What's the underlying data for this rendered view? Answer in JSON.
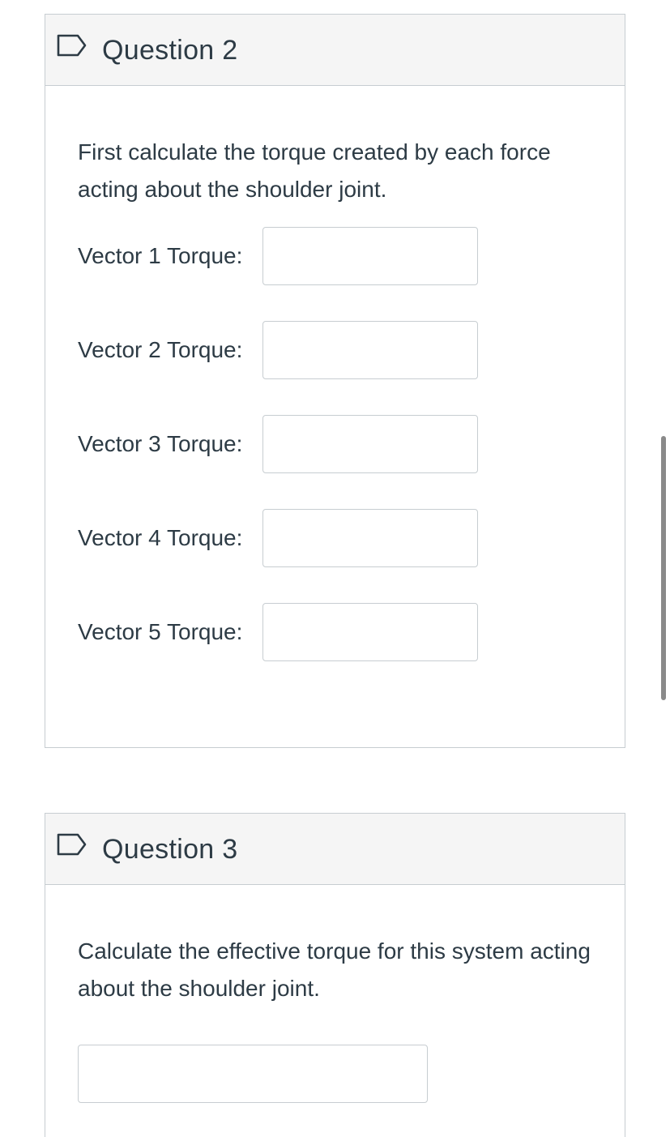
{
  "questions": [
    {
      "title": "Question 2",
      "text": "First calculate the torque created by each force acting about the shoulder joint.",
      "fields": [
        {
          "label": "Vector 1 Torque:",
          "value": ""
        },
        {
          "label": "Vector 2 Torque:",
          "value": ""
        },
        {
          "label": "Vector 3 Torque:",
          "value": ""
        },
        {
          "label": "Vector 4 Torque:",
          "value": ""
        },
        {
          "label": "Vector 5 Torque:",
          "value": ""
        }
      ]
    },
    {
      "title": "Question 3",
      "text": "Calculate the effective torque for this system acting about the shoulder joint.",
      "answer_value": ""
    }
  ],
  "icons": {
    "flag": "bookmark-flag-icon"
  },
  "colors": {
    "text": "#2d3b45",
    "border": "#c7cdd1",
    "header_bg": "#f5f5f5",
    "scrollbar": "#8a8a8a"
  }
}
